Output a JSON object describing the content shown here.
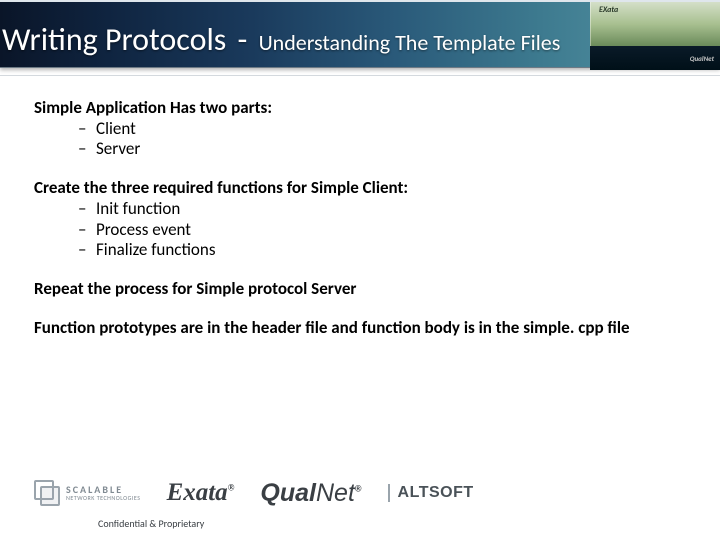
{
  "header": {
    "title_main": "Writing Protocols",
    "title_sep": "-",
    "title_sub": "Understanding The Template Files",
    "corner_small": "EXata",
    "corner_brand": "QualNet"
  },
  "content": {
    "section1_lead": "Simple Application Has two parts:",
    "section1_items": [
      "Client",
      "Server"
    ],
    "section2_lead": "Create the three required functions for Simple Client:",
    "section2_items": [
      "Init function",
      "Process event",
      "Finalize functions"
    ],
    "section3": "Repeat the process for Simple protocol Server",
    "section4": "Function prototypes are in the header file and function body is in the simple. cpp file"
  },
  "logos": {
    "scalable_line1": "SCALABLE",
    "scalable_line2": "NETWORK TECHNOLOGIES",
    "exata": "Exata",
    "qualnet_a": "Qual",
    "qualnet_b": "Net",
    "reg": "®",
    "altsoft": "ALTSOFT"
  },
  "footer": {
    "confidential": "Confidential & Proprietary"
  }
}
